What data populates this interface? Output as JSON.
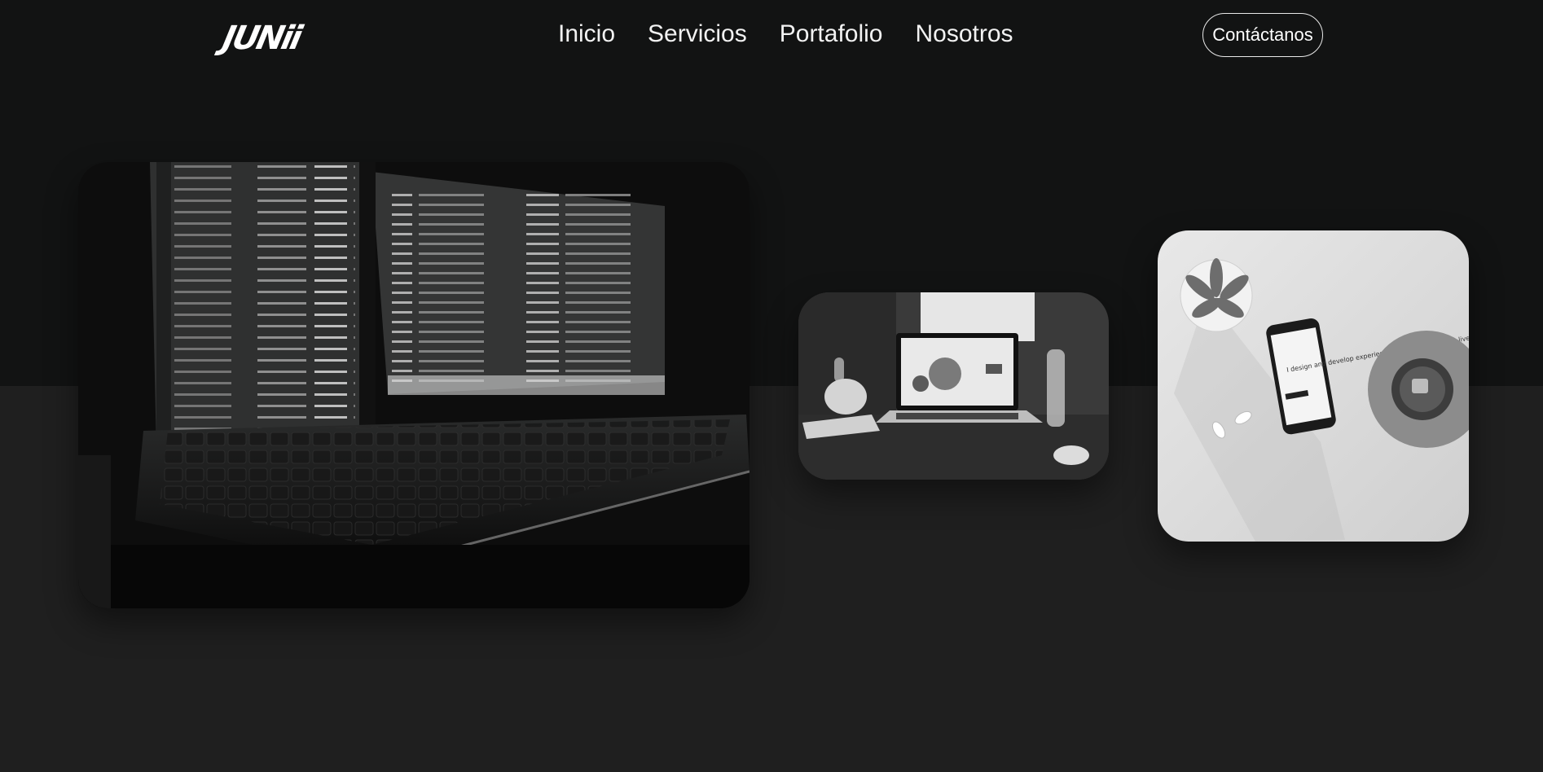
{
  "brand": {
    "logo_text": "JUNii"
  },
  "nav": {
    "links": [
      "Inicio",
      "Servicios",
      "Portafolio",
      "Nosotros"
    ],
    "contact_label": "Contáctanos"
  },
  "gallery": {
    "phone_screen_text": "I design and develop experiences that make peoples lives simple."
  },
  "colors": {
    "background_top": "#121313",
    "background_bottom": "#1f1f1f",
    "text": "#ffffff"
  }
}
